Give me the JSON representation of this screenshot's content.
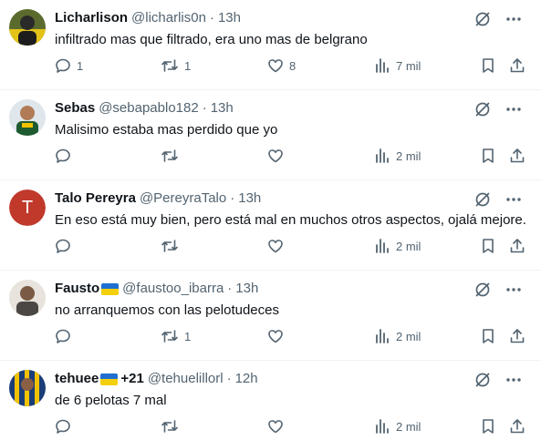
{
  "tweets": [
    {
      "name": "Licharlison",
      "handle": "@licharlis0n",
      "time": "13h",
      "has_flag": false,
      "extra": "",
      "text": "infiltrado mas que filtrado, era uno mas de belgrano",
      "replies": "1",
      "retweets": "1",
      "likes": "8",
      "views": "7 mil",
      "avatar": "photo"
    },
    {
      "name": "Sebas",
      "handle": "@sebapablo182",
      "time": "13h",
      "has_flag": false,
      "extra": "",
      "text": "Malisimo estaba mas perdido que yo",
      "replies": "",
      "retweets": "",
      "likes": "",
      "views": "2 mil",
      "avatar": "photo"
    },
    {
      "name": "Talo Pereyra",
      "handle": "@PereyraTalo",
      "time": "13h",
      "has_flag": false,
      "extra": "",
      "text": "En eso está muy bien, pero está mal en muchos otros aspectos, ojalá mejore.",
      "replies": "",
      "retweets": "",
      "likes": "",
      "views": "2 mil",
      "avatar": "letter",
      "avatar_letter": "T"
    },
    {
      "name": "Fausto",
      "handle": "@faustoo_ibarra",
      "time": "13h",
      "has_flag": true,
      "extra": "",
      "text": "no arranquemos con las pelotudeces",
      "replies": "",
      "retweets": "1",
      "likes": "",
      "views": "2 mil",
      "avatar": "photo"
    },
    {
      "name": "tehuee",
      "handle": "@tehuelillorl",
      "time": "12h",
      "has_flag": true,
      "extra": "+21",
      "text": "de 6 pelotas 7 mal",
      "replies": "",
      "retweets": "",
      "likes": "",
      "views": "2 mil",
      "avatar": "photo"
    }
  ],
  "icons": {
    "grok": "grok-icon",
    "more": "more-icon",
    "reply": "reply-icon",
    "retweet": "retweet-icon",
    "like": "like-icon",
    "views": "views-icon",
    "bookmark": "bookmark-icon",
    "share": "share-icon"
  },
  "colors": {
    "text": "#0f1419",
    "muted": "#536471",
    "divider": "#eff3f4",
    "flag_blue": "#1f6fd1",
    "flag_yellow": "#f4cf0b",
    "avatar_letter_bg": "#c0392b"
  }
}
